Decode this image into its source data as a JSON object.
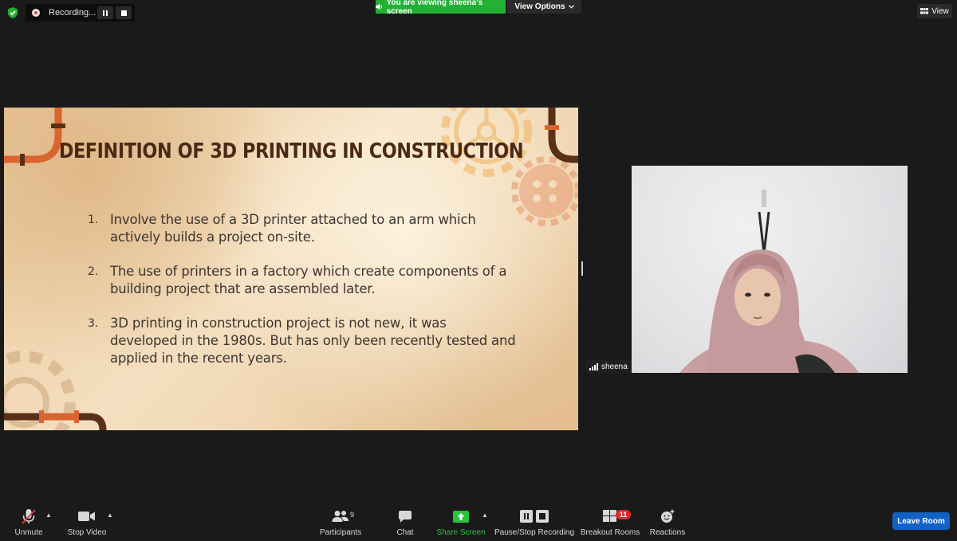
{
  "topbar": {
    "recording_label": "Recording...",
    "viewing_banner": "You are viewing sheena's screen",
    "view_options_label": "View Options",
    "view_label": "View"
  },
  "slide": {
    "title": "DEFINITION OF 3D PRINTING IN CONSTRUCTION",
    "items": [
      {
        "number": "1.",
        "lines": [
          "Involve the use of a 3D printer attached to an arm which",
          "actively builds a project on-site."
        ]
      },
      {
        "number": "2.",
        "lines": [
          "The use of printers in a factory which create components of a",
          "building project that are assembled later."
        ]
      },
      {
        "number": "3.",
        "lines": [
          "3D printing in construction project is not new, it was",
          "developed in the 1980s. But has only been recently tested and",
          "applied in the recent years."
        ]
      }
    ]
  },
  "participant": {
    "name": "sheena"
  },
  "toolbar": {
    "unmute": "Unmute",
    "stop_video": "Stop Video",
    "participants": "Participants",
    "participants_count": "9",
    "chat": "Chat",
    "share_screen": "Share Screen",
    "pause_stop_recording": "Pause/Stop Recording",
    "breakout_rooms": "Breakout Rooms",
    "breakout_badge": "11",
    "reactions": "Reactions",
    "leave_room": "Leave Room"
  },
  "colors": {
    "share_green": "#22b035",
    "leave_blue": "#1262c6",
    "badge_red": "#e02a2a",
    "slide_title": "#4a2a16",
    "pipe_orange": "#d8652f",
    "pipe_brown": "#5a3019"
  }
}
